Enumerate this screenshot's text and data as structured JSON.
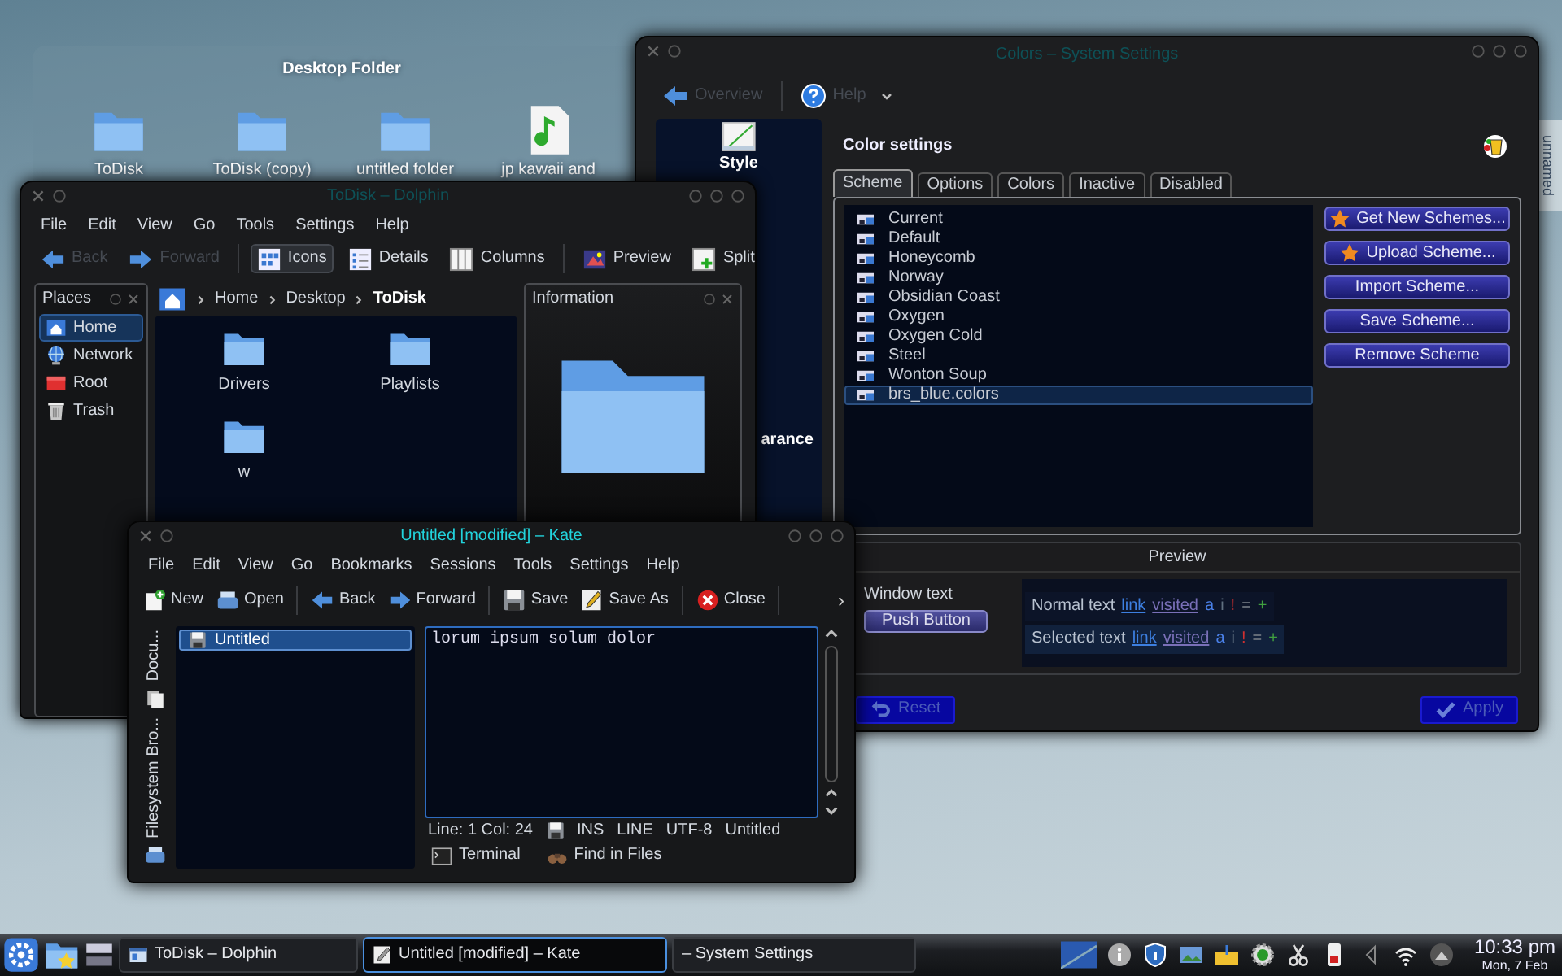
{
  "desktop_folder": {
    "title": "Desktop Folder",
    "items": [
      {
        "label": "ToDisk",
        "kind": "folder"
      },
      {
        "label": "ToDisk (copy)",
        "kind": "folder"
      },
      {
        "label": "untitled folder",
        "kind": "folder"
      },
      {
        "label": "jp kawaii and",
        "kind": "audio"
      }
    ]
  },
  "desktop_widget": {
    "label": "unnamed"
  },
  "settings_window": {
    "title": "Colors – System Settings",
    "active": false,
    "toolbar": [
      {
        "label": "Overview",
        "kind": "back",
        "disabled": true
      },
      {
        "label": "Help",
        "kind": "help",
        "disabled": true
      }
    ],
    "sidebar": [
      {
        "label": "Style",
        "kind": "style"
      },
      {
        "label": "arance",
        "kind": "text"
      }
    ],
    "heading": "Color settings",
    "tabs": [
      {
        "label": "Scheme",
        "selected": true
      },
      {
        "label": "Options",
        "selected": false
      },
      {
        "label": "Colors",
        "selected": false
      },
      {
        "label": "Inactive",
        "selected": false
      },
      {
        "label": "Disabled",
        "selected": false
      }
    ],
    "schemes": [
      {
        "name": "Current",
        "selected": false
      },
      {
        "name": "Default",
        "selected": false
      },
      {
        "name": "Honeycomb",
        "selected": false
      },
      {
        "name": "Norway",
        "selected": false
      },
      {
        "name": "Obsidian Coast",
        "selected": false
      },
      {
        "name": "Oxygen",
        "selected": false
      },
      {
        "name": "Oxygen Cold",
        "selected": false
      },
      {
        "name": "Steel",
        "selected": false
      },
      {
        "name": "Wonton Soup",
        "selected": false
      },
      {
        "name": "brs_blue.colors",
        "selected": true
      }
    ],
    "actions": [
      {
        "label": "Get New Schemes...",
        "kind": "star"
      },
      {
        "label": "Upload Scheme...",
        "kind": "star"
      },
      {
        "label": "Import Scheme...",
        "kind": "plain"
      },
      {
        "label": "Save Scheme...",
        "kind": "plain"
      },
      {
        "label": "Remove Scheme",
        "kind": "plain"
      }
    ],
    "preview": {
      "title": "Preview",
      "window_text": "Window text",
      "push_button": "Push Button",
      "rows": [
        {
          "label": "Normal text",
          "selected": false,
          "parts": [
            {
              "text": "link",
              "kind": "link"
            },
            {
              "text": "visited",
              "kind": "visited"
            },
            {
              "text": "a",
              "kind": "active"
            },
            {
              "text": "i",
              "kind": "inactive"
            },
            {
              "text": "!",
              "kind": "negative"
            },
            {
              "text": "=",
              "kind": "neutral"
            },
            {
              "text": "+",
              "kind": "positive"
            }
          ]
        },
        {
          "label": "Selected text",
          "selected": true,
          "parts": [
            {
              "text": "link",
              "kind": "link"
            },
            {
              "text": "visited",
              "kind": "visited"
            },
            {
              "text": "a",
              "kind": "active"
            },
            {
              "text": "i",
              "kind": "inactive"
            },
            {
              "text": "!",
              "kind": "negative"
            },
            {
              "text": "=",
              "kind": "neutral"
            },
            {
              "text": "+",
              "kind": "positive"
            }
          ]
        }
      ]
    },
    "footer": [
      {
        "label": "Reset",
        "kind": "reset",
        "disabled": true
      },
      {
        "label": "Apply",
        "kind": "apply",
        "disabled": true
      }
    ]
  },
  "dolphin_window": {
    "title": "ToDisk – Dolphin",
    "active": false,
    "menu": [
      "File",
      "Edit",
      "View",
      "Go",
      "Tools",
      "Settings",
      "Help"
    ],
    "toolbar": [
      [
        {
          "label": "Back",
          "kind": "back",
          "disabled": true,
          "checked": false
        },
        {
          "label": "Forward",
          "kind": "forward",
          "disabled": true,
          "checked": false
        }
      ],
      [
        {
          "label": "Icons",
          "kind": "icons",
          "disabled": false,
          "checked": true
        },
        {
          "label": "Details",
          "kind": "details",
          "disabled": false,
          "checked": false
        },
        {
          "label": "Columns",
          "kind": "columns",
          "disabled": false,
          "checked": false
        }
      ],
      [
        {
          "label": "Preview",
          "kind": "preview",
          "disabled": false,
          "checked": false
        },
        {
          "label": "Split",
          "kind": "split",
          "disabled": false,
          "checked": false
        }
      ]
    ],
    "places": {
      "title": "Places",
      "items": [
        {
          "label": "Home",
          "kind": "home",
          "selected": true
        },
        {
          "label": "Network",
          "kind": "network",
          "selected": false
        },
        {
          "label": "Root",
          "kind": "root",
          "selected": false
        },
        {
          "label": "Trash",
          "kind": "trash",
          "selected": false
        }
      ]
    },
    "breadcrumb": [
      {
        "label": "Home",
        "current": false
      },
      {
        "label": "Desktop",
        "current": false
      },
      {
        "label": "ToDisk",
        "current": true
      }
    ],
    "files": [
      {
        "name": "Drivers"
      },
      {
        "name": "Playlists"
      },
      {
        "name": "w"
      }
    ],
    "info_panel": {
      "title": "Information"
    }
  },
  "kate_window": {
    "title": "Untitled [modified] – Kate",
    "active": true,
    "menu": [
      "File",
      "Edit",
      "View",
      "Go",
      "Bookmarks",
      "Sessions",
      "Tools",
      "Settings",
      "Help"
    ],
    "toolbar": [
      [
        {
          "label": "New",
          "kind": "new"
        },
        {
          "label": "Open",
          "kind": "open"
        }
      ],
      [
        {
          "label": "Back",
          "kind": "back"
        },
        {
          "label": "Forward",
          "kind": "forward"
        }
      ],
      [
        {
          "label": "Save",
          "kind": "save"
        },
        {
          "label": "Save As",
          "kind": "saveas"
        }
      ],
      [
        {
          "label": "Close",
          "kind": "close"
        }
      ]
    ],
    "toolbar_overflow": "›",
    "side_tabs": [
      {
        "label": "Docu...",
        "kind": "documents"
      },
      {
        "label": "Filesystem Bro...",
        "kind": "filesystem"
      }
    ],
    "documents": [
      {
        "name": "Untitled",
        "selected": true
      }
    ],
    "editor_text": "lorum ipsum solum dolor",
    "status": {
      "position": "Line: 1 Col: 24",
      "mode": "INS",
      "selection": "LINE",
      "encoding": "UTF-8",
      "document": "Untitled"
    },
    "bottom_tabs": [
      {
        "label": "Terminal",
        "kind": "terminal"
      },
      {
        "label": "Find in Files",
        "kind": "find"
      }
    ]
  },
  "taskbar": {
    "tasks": [
      {
        "label": "ToDisk – Dolphin",
        "kind": "dolphin",
        "selected": false
      },
      {
        "label": "Untitled [modified] – Kate",
        "kind": "kate",
        "selected": true
      },
      {
        "label": "– System Settings",
        "kind": "none",
        "selected": false
      }
    ],
    "time": "10:33 pm",
    "date": "Mon, 7 Feb"
  }
}
